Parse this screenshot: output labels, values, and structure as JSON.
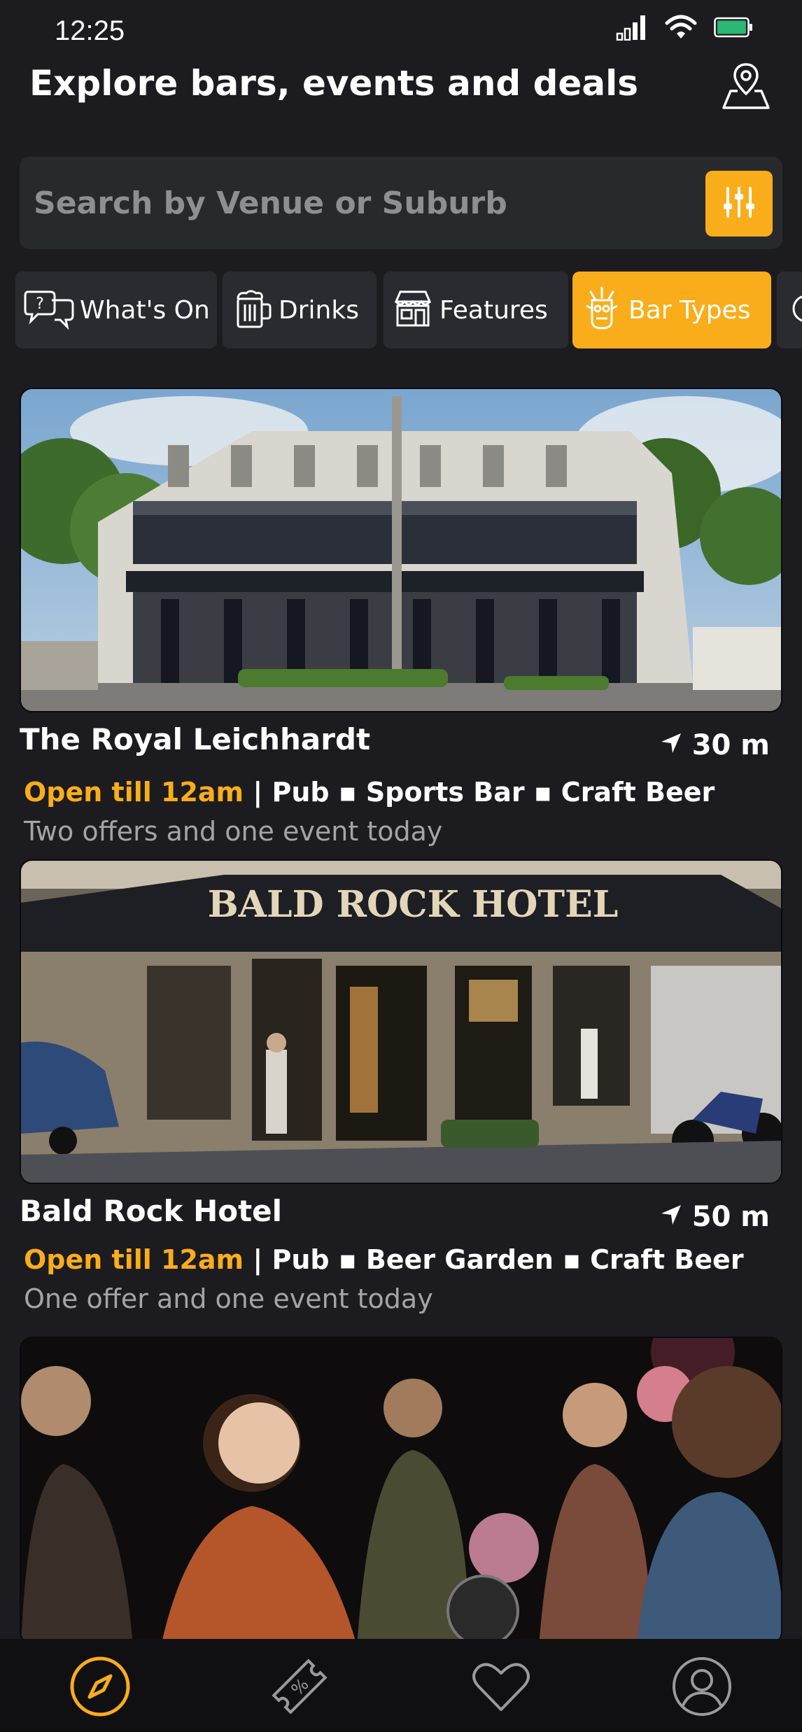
{
  "status": {
    "time": "12:25",
    "battery_color": "#2bb673"
  },
  "header": {
    "title": "Explore bars, events and deals",
    "map_icon": "map-pin-icon"
  },
  "search": {
    "placeholder": "Search by Venue or Suburb",
    "filter_icon": "sliders-icon"
  },
  "chips": [
    {
      "label": "What's On",
      "icon": "chat-bubbles-icon",
      "active": false
    },
    {
      "label": "Drinks",
      "icon": "beer-mug-icon",
      "active": false
    },
    {
      "label": "Features",
      "icon": "storefront-icon",
      "active": false
    },
    {
      "label": "Bar Types",
      "icon": "tiki-mask-icon",
      "active": true
    }
  ],
  "venues": [
    {
      "name": "The Royal Leichhardt",
      "distance": "30 m",
      "open_status": "Open till 12am",
      "tags": "| Pub ▪ Sports Bar ▪ Craft Beer",
      "offers": "Two offers and one event today"
    },
    {
      "name": "Bald Rock Hotel",
      "distance": "50 m",
      "open_status": "Open till 12am",
      "tags": "| Pub ▪ Beer Garden ▪ Craft Beer",
      "offers": "One offer and one event today",
      "sign_text": "BALD ROCK HOTEL"
    }
  ],
  "nav": [
    {
      "icon": "compass-icon",
      "active": true
    },
    {
      "icon": "discount-ticket-icon",
      "active": false
    },
    {
      "icon": "heart-icon",
      "active": false
    },
    {
      "icon": "profile-icon",
      "active": false
    }
  ],
  "colors": {
    "accent": "#f9ad1b",
    "background": "#1c1c20",
    "card": "#2a2b30",
    "muted_text": "#a4a4a8"
  }
}
